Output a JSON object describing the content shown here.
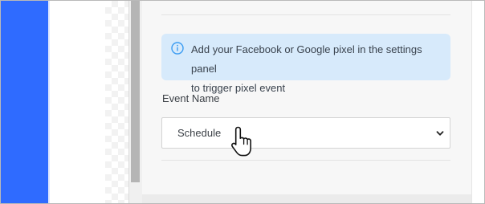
{
  "info": {
    "line1": "Add your Facebook or Google pixel in the settings panel",
    "line2": "to trigger pixel event",
    "icon": "info-circle-icon",
    "color": "#d7eafb"
  },
  "event": {
    "label": "Event Name",
    "selected": "Schedule"
  },
  "colors": {
    "accent": "#2f6bff",
    "panel": "#f7f7f7"
  }
}
